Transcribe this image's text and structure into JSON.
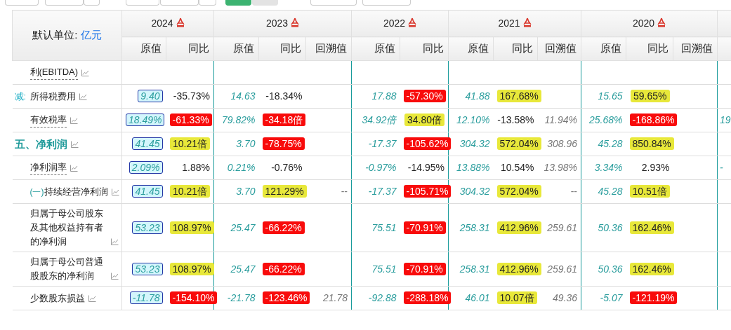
{
  "unit_label": "默认单位:",
  "unit": "亿元",
  "years": [
    {
      "year": "2024",
      "columns": [
        "原值",
        "同比"
      ]
    },
    {
      "year": "2023",
      "columns": [
        "原值",
        "同比",
        "回溯值"
      ]
    },
    {
      "year": "2022",
      "columns": [
        "原值",
        "同比"
      ]
    },
    {
      "year": "2021",
      "columns": [
        "原值",
        "同比",
        "回溯值"
      ]
    },
    {
      "year": "2020",
      "columns": [
        "原值",
        "同比",
        "回溯值"
      ]
    }
  ],
  "rows": [
    {
      "label": "利(EBITDA)",
      "kind": "item",
      "dashed": true
    },
    {
      "gutter": "减:",
      "label": "所得税费用",
      "kind": "item",
      "dashed": false,
      "cells": [
        {
          "text": "9.40",
          "kind": "boxed"
        },
        {
          "text": "-35.73%",
          "kind": "plain"
        },
        {
          "text": "14.63",
          "kind": "raw"
        },
        {
          "text": "-18.34%",
          "kind": "plain"
        },
        null,
        {
          "text": "17.88",
          "kind": "raw"
        },
        {
          "text": "-57.30%",
          "kind": "down"
        },
        {
          "text": "41.88",
          "kind": "raw"
        },
        {
          "text": "167.68%",
          "kind": "up"
        },
        null,
        {
          "text": "15.65",
          "kind": "raw"
        },
        {
          "text": "59.65%",
          "kind": "up"
        },
        null
      ]
    },
    {
      "label": "有效税率",
      "kind": "item",
      "dashed": true,
      "cells": [
        {
          "text": "18.49%",
          "kind": "boxed"
        },
        {
          "text": "-61.33%",
          "kind": "down"
        },
        {
          "text": "79.82%",
          "kind": "raw"
        },
        {
          "text": "-34.18倍",
          "kind": "down"
        },
        null,
        {
          "text": "34.92倍",
          "kind": "raw"
        },
        {
          "text": "34.80倍",
          "kind": "up"
        },
        {
          "text": "12.10%",
          "kind": "raw"
        },
        {
          "text": "-13.58%",
          "kind": "plain"
        },
        {
          "text": "11.94%",
          "kind": "restated"
        },
        {
          "text": "25.68%",
          "kind": "raw"
        },
        {
          "text": "-168.86%",
          "kind": "down"
        },
        null
      ],
      "next": "19"
    },
    {
      "label": "五、净利润",
      "kind": "section",
      "dashed": false,
      "cells": [
        {
          "text": "41.45",
          "kind": "boxed"
        },
        {
          "text": "10.21倍",
          "kind": "up"
        },
        {
          "text": "3.70",
          "kind": "raw"
        },
        {
          "text": "-78.75%",
          "kind": "down"
        },
        null,
        {
          "text": "-17.37",
          "kind": "raw"
        },
        {
          "text": "-105.62%",
          "kind": "down"
        },
        {
          "text": "304.32",
          "kind": "raw"
        },
        {
          "text": "572.04%",
          "kind": "up"
        },
        {
          "text": "308.96",
          "kind": "restated"
        },
        {
          "text": "45.28",
          "kind": "raw"
        },
        {
          "text": "850.84%",
          "kind": "up"
        },
        null
      ]
    },
    {
      "label": "净利润率",
      "kind": "item",
      "dashed": true,
      "cells": [
        {
          "text": "2.09%",
          "kind": "boxed"
        },
        {
          "text": "1.88%",
          "kind": "plain"
        },
        {
          "text": "0.21%",
          "kind": "raw"
        },
        {
          "text": "-0.76%",
          "kind": "plain"
        },
        null,
        {
          "text": "-0.97%",
          "kind": "raw"
        },
        {
          "text": "-14.95%",
          "kind": "plain"
        },
        {
          "text": "13.88%",
          "kind": "raw"
        },
        {
          "text": "10.54%",
          "kind": "plain"
        },
        {
          "text": "13.98%",
          "kind": "restated"
        },
        {
          "text": "3.34%",
          "kind": "raw"
        },
        {
          "text": "2.93%",
          "kind": "plain"
        },
        null
      ],
      "next": "-"
    },
    {
      "prefix": "(一)",
      "label": "持续经营净利润",
      "kind": "item",
      "dashed": false,
      "cells": [
        {
          "text": "41.45",
          "kind": "boxed"
        },
        {
          "text": "10.21倍",
          "kind": "up"
        },
        {
          "text": "3.70",
          "kind": "raw"
        },
        {
          "text": "121.29%",
          "kind": "up"
        },
        {
          "text": "--",
          "kind": "restated-plain"
        },
        {
          "text": "-17.37",
          "kind": "raw"
        },
        {
          "text": "-105.71%",
          "kind": "down"
        },
        {
          "text": "304.32",
          "kind": "raw"
        },
        {
          "text": "572.04%",
          "kind": "up"
        },
        {
          "text": "--",
          "kind": "restated-plain"
        },
        {
          "text": "45.28",
          "kind": "raw"
        },
        {
          "text": "10.51倍",
          "kind": "up"
        },
        null
      ]
    },
    {
      "label": "归属于母公司股东及其他权益持有者的净利润",
      "kind": "item",
      "dashed": false,
      "cells": [
        {
          "text": "53.23",
          "kind": "boxed"
        },
        {
          "text": "108.97%",
          "kind": "up"
        },
        {
          "text": "25.47",
          "kind": "raw"
        },
        {
          "text": "-66.22%",
          "kind": "down"
        },
        null,
        {
          "text": "75.51",
          "kind": "raw"
        },
        {
          "text": "-70.91%",
          "kind": "down"
        },
        {
          "text": "258.31",
          "kind": "raw"
        },
        {
          "text": "412.96%",
          "kind": "up"
        },
        {
          "text": "259.61",
          "kind": "restated"
        },
        {
          "text": "50.36",
          "kind": "raw"
        },
        {
          "text": "162.46%",
          "kind": "up"
        },
        null
      ]
    },
    {
      "label": "归属于母公司普通股股东的净利润",
      "kind": "item",
      "dashed": false,
      "cells": [
        {
          "text": "53.23",
          "kind": "boxed"
        },
        {
          "text": "108.97%",
          "kind": "up"
        },
        {
          "text": "25.47",
          "kind": "raw"
        },
        {
          "text": "-66.22%",
          "kind": "down"
        },
        null,
        {
          "text": "75.51",
          "kind": "raw"
        },
        {
          "text": "-70.91%",
          "kind": "down"
        },
        {
          "text": "258.31",
          "kind": "raw"
        },
        {
          "text": "412.96%",
          "kind": "up"
        },
        {
          "text": "259.61",
          "kind": "restated"
        },
        {
          "text": "50.36",
          "kind": "raw"
        },
        {
          "text": "162.46%",
          "kind": "up"
        },
        null
      ]
    },
    {
      "label": "少数股东损益",
      "kind": "item",
      "dashed": false,
      "cells": [
        {
          "text": "-11.78",
          "kind": "boxed"
        },
        {
          "text": "-154.10%",
          "kind": "down"
        },
        {
          "text": "-21.78",
          "kind": "raw"
        },
        {
          "text": "-123.46%",
          "kind": "down"
        },
        {
          "text": "21.78",
          "kind": "restated"
        },
        {
          "text": "-92.88",
          "kind": "raw"
        },
        {
          "text": "-288.18%",
          "kind": "down"
        },
        {
          "text": "46.01",
          "kind": "raw"
        },
        {
          "text": "10.07倍",
          "kind": "up"
        },
        {
          "text": "49.36",
          "kind": "restated"
        },
        {
          "text": "-5.07",
          "kind": "raw"
        },
        {
          "text": "-121.19%",
          "kind": "down"
        },
        null
      ]
    }
  ]
}
